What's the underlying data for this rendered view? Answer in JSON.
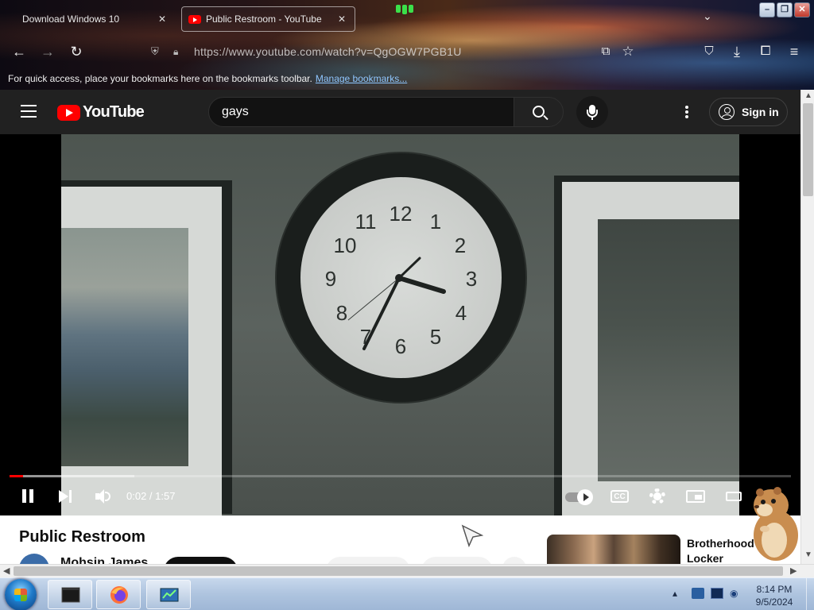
{
  "browser": {
    "tabs": [
      {
        "title": "Download Windows 10",
        "active": false
      },
      {
        "title": "Public Restroom - YouTube",
        "active": true
      }
    ],
    "url": "https://www.youtube.com/watch?v=QgOGW7PGB1U",
    "bookmarks_message": "For quick access, place your bookmarks here on the bookmarks toolbar.",
    "bookmarks_link": "Manage bookmarks..."
  },
  "youtube": {
    "logo_text": "YouTube",
    "search_value": "gays",
    "sign_in_label": "Sign in",
    "player": {
      "current_time": "0:02",
      "duration": "1:57",
      "time_display": "0:02 / 1:57",
      "progress_fraction": 0.017,
      "buffered_fraction": 0.16,
      "cc_label": "CC"
    },
    "video_title": "Public Restroom",
    "channel_name": "Mohsin James",
    "recommended": [
      {
        "title": "Brotherhood Locker Room..."
      }
    ]
  },
  "taskbar": {
    "time": "8:14 PM",
    "date": "9/5/2024"
  },
  "colors": {
    "youtube_red": "#ff0000",
    "youtube_dark": "#0f0f0f",
    "header_bg": "#212121",
    "taskbar_blue": "#aec4df"
  }
}
